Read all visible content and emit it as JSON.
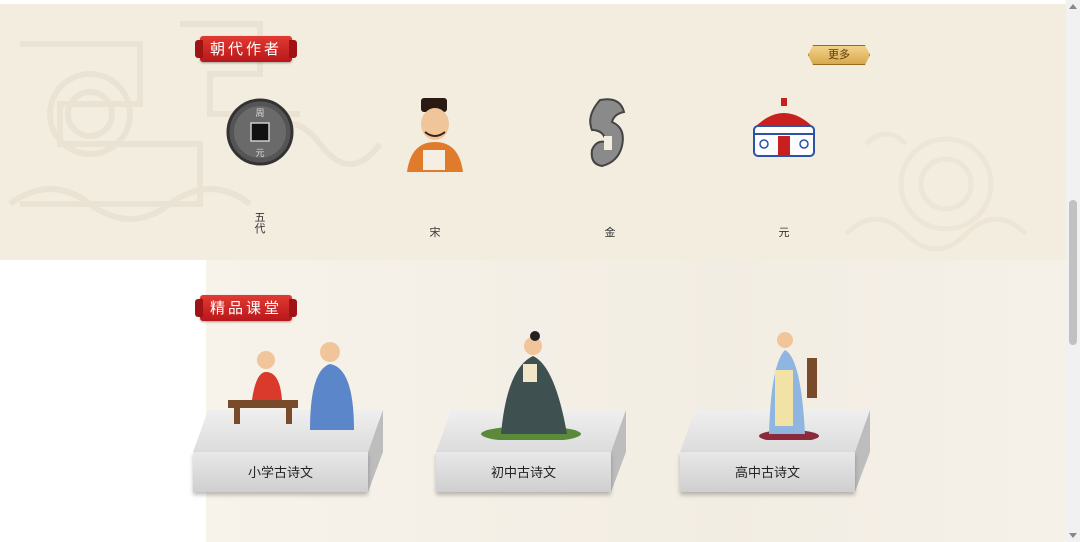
{
  "dynasty_section": {
    "title": "朝代作者",
    "more_label": "更多",
    "items": [
      {
        "label": "五代",
        "icon": "coin-icon"
      },
      {
        "label": "宋",
        "icon": "song-scholar-icon"
      },
      {
        "label": "金",
        "icon": "jade-dragon-icon"
      },
      {
        "label": "元",
        "icon": "yurt-icon"
      }
    ]
  },
  "classroom_section": {
    "title": "精品课堂",
    "courses": [
      {
        "label": "小学古诗文",
        "icon": "teacher-student-icon"
      },
      {
        "label": "初中古诗文",
        "icon": "seated-lady-icon"
      },
      {
        "label": "高中古诗文",
        "icon": "standing-scholar-icon"
      }
    ]
  },
  "colors": {
    "ribbon_red": "#c8201f",
    "panel_beige": "#f3ede0"
  }
}
